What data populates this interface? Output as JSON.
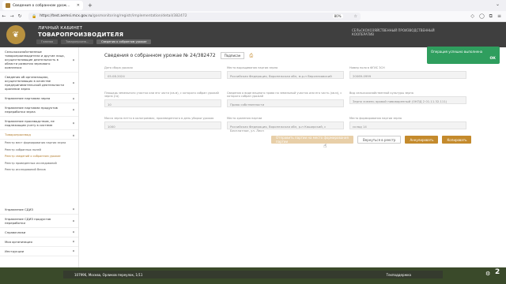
{
  "browser": {
    "tab_title": "Сведения о собранном урож...",
    "url_host": "https://test.aemsi.mcx.gov.ru",
    "url_path": "/gosmonitoring/registr/implementation/detail/382472",
    "zoom": "80%"
  },
  "header": {
    "cabinet_line1": "ЛИЧНЫЙ КАБИНЕТ",
    "cabinet_line2": "ТОВАРОПРОИЗВОДИТЕЛЯ",
    "ministry": "СЕЛЬСКОХОЗЯЙСТВЕННЫЙ ПРОИЗВОДСТВЕННЫЙ КООПЕРАТИВ",
    "breadcrumbs": [
      "Главная",
      "Товаропроизв...",
      "Сведения о собранном урожае"
    ]
  },
  "toast": {
    "text": "Операция успешно выполнена",
    "ok": "ОК"
  },
  "sidebar": {
    "items": [
      {
        "label": "Сельскохозяйственные товаропроизводители и другие лица, осуществляющие деятельность в области развития зернового комплекса",
        "chev": "▾"
      },
      {
        "label": "Сведения об организациях, осуществляющих в качестве предпринимательской деятельности хранение зерна",
        "chev": "▾"
      },
      {
        "label": "Управление партиями зерна",
        "chev": "▾"
      },
      {
        "label": "Управление партиями продуктов переработки зерна",
        "chev": "▾"
      },
      {
        "label": "Управление производством, не подлежащим учету в системе",
        "chev": "▾"
      }
    ],
    "section": {
      "label": "Товаропроизвод",
      "chev": "▴"
    },
    "subitems": [
      "Реестр мест формирования партии зерна",
      "Реестр собранных полей",
      "Реестр сведений о собранном урожае",
      "Реестр проведенных исследований",
      "Реестр исследований Весов"
    ],
    "bottom_items": [
      {
        "label": "Управление СДИЗ",
        "chev": "▾"
      },
      {
        "label": "Управление СДИЗ продуктов переработки",
        "chev": "▾"
      },
      {
        "label": "Справочники",
        "chev": "▾"
      },
      {
        "label": "Моя организация",
        "chev": "▾"
      },
      {
        "label": "Инструкции",
        "chev": "▾"
      }
    ]
  },
  "main": {
    "title": "Сведения о собранном урожае № 24/382472",
    "sign_label": "Подписан",
    "fields": [
      {
        "label": "Дата сбора урожая",
        "value": "05.08.2024"
      },
      {
        "label": "Место выращивания партии зерна",
        "value": "Российская Федерация, Воронежская обл, м.р-н Верхнехавский"
      },
      {
        "label": "Номер поля в ФГИС ЗСН",
        "value": "20069-0999"
      },
      {
        "label": "Площадь земельного участка или его части (кв.м), с которого собран урожай зерна (га)",
        "value": "10"
      },
      {
        "label": "Сведения о виде вещного права на земельный участок или его часть (кв.м), с которого собран урожай",
        "value": "Право собственности"
      },
      {
        "label": "Вид сельскохозяйственной культуры зерна",
        "value": "Зерно ячмень яровой пивоваренный (ОКПД 2 01.11.32.111)"
      },
      {
        "label": "Масса зерна нетто в килограммах, произведенного в день уборки урожая",
        "value": "1000"
      },
      {
        "label": "Место хранения партии",
        "value": "Российская Федерация, Воронежская обл, р-н Каширский, с Бесплатное, ул. Лесн"
      },
      {
        "label": "Место формирования партии зерна",
        "value": "склад 14"
      }
    ],
    "buttons": {
      "send": "Отправить партии на место формирования партии",
      "back": "Вернуться в реестр",
      "cancel": "Аннулировать",
      "copy": "Копировать"
    }
  },
  "footer": {
    "address": "107996, Москва, Орликов переулок, 1/11",
    "support": "Техподдержка"
  },
  "badge_count": "2"
}
